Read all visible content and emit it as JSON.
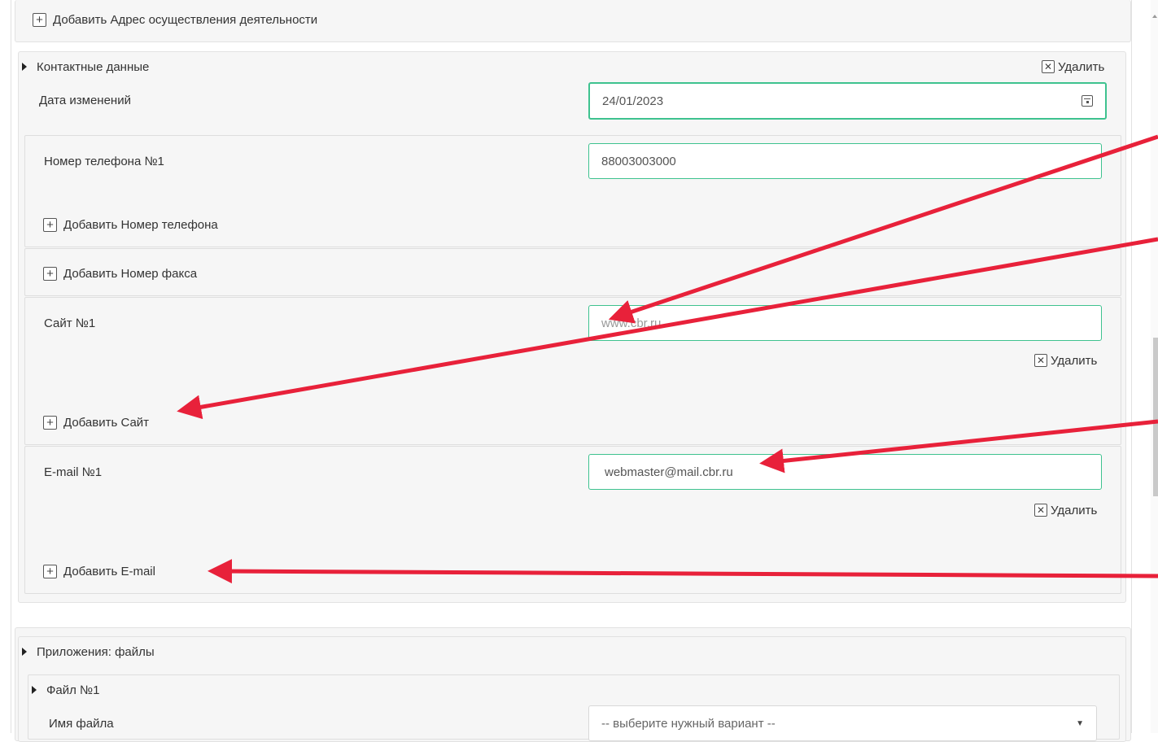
{
  "top_add": {
    "label": "Добавить Адрес осуществления деятельности"
  },
  "contacts": {
    "title": "Контактные данные",
    "delete_label": "Удалить",
    "date_label": "Дата изменений",
    "date_value": "24/01/2023",
    "phone": {
      "label": "Номер телефона №1",
      "value": "88003003000",
      "add_label": "Добавить Номер телефона"
    },
    "fax": {
      "add_label": "Добавить Номер факса"
    },
    "site": {
      "label": "Сайт №1",
      "value": "www.cbr.ru",
      "delete_label": "Удалить",
      "add_label": "Добавить Сайт"
    },
    "email": {
      "label": "E-mail №1",
      "value": "webmaster@mail.cbr.ru",
      "delete_label": "Удалить",
      "add_label": "Добавить E-mail"
    }
  },
  "attachments": {
    "title": "Приложения: файлы",
    "file": {
      "title": "Файл №1",
      "name_label": "Имя файла",
      "select_value": "-- выберите нужный вариант --"
    }
  },
  "icons": {
    "plus": "plus-square-icon",
    "close": "close-square-icon",
    "calendar": "calendar-icon",
    "triangle": "triangle-right-icon",
    "dropdown": "caret-down-icon"
  },
  "colors": {
    "accent": "#3ec28f",
    "annotation_arrow": "#e8213a",
    "panel_bg": "#f6f6f6"
  }
}
